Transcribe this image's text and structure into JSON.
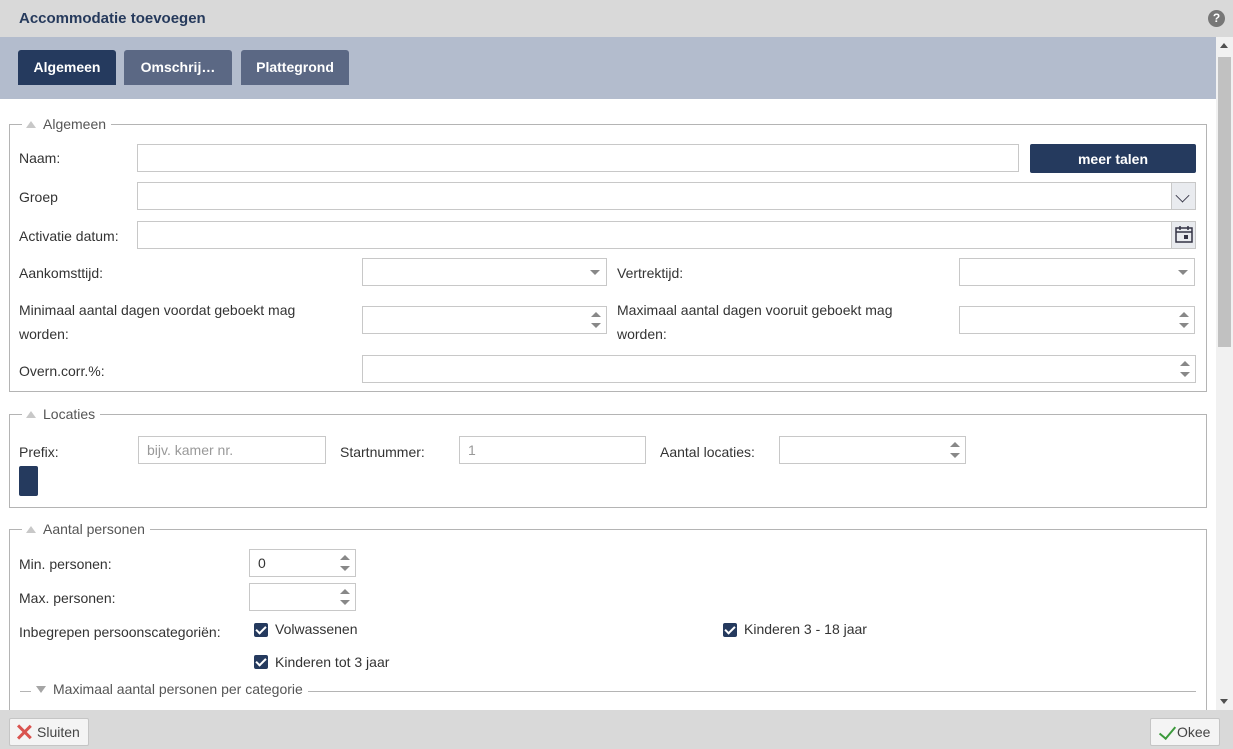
{
  "window": {
    "title": "Accommodatie toevoegen",
    "help_glyph": "?"
  },
  "tabs": [
    {
      "label": "Algemeen",
      "active": true
    },
    {
      "label": "Omschrij…",
      "active": false
    },
    {
      "label": "Plattegrond",
      "active": false
    }
  ],
  "algemeen": {
    "legend": "Algemeen",
    "naam_label": "Naam:",
    "naam_value": "",
    "meer_talen_label": "meer talen",
    "groep_label": "Groep",
    "groep_value": "",
    "activatie_label": "Activatie datum:",
    "activatie_value": "",
    "aankomst_label": "Aankomsttijd:",
    "vertrek_label": "Vertrektijd:",
    "min_dagen_label_1": "Minimaal aantal dagen voordat geboekt mag",
    "min_dagen_label_2": "worden:",
    "max_dagen_label_1": "Maximaal aantal dagen vooruit geboekt mag",
    "max_dagen_label_2": "worden:",
    "overn_label": "Overn.corr.%:"
  },
  "locaties": {
    "legend": "Locaties",
    "prefix_label": "Prefix:",
    "prefix_placeholder": "bijv. kamer nr.",
    "startnummer_label": "Startnummer:",
    "startnummer_placeholder": "1",
    "aantal_label": "Aantal locaties:"
  },
  "personen": {
    "legend": "Aantal personen",
    "min_label": "Min. personen:",
    "min_value": "0",
    "max_label": "Max. personen:",
    "max_value": "",
    "categorieen_label": "Inbegrepen persoonscategoriën:",
    "categories": [
      {
        "label": "Volwassenen",
        "checked": true
      },
      {
        "label": "Kinderen 3 - 18 jaar",
        "checked": true
      },
      {
        "label": "Kinderen tot 3 jaar",
        "checked": true
      }
    ],
    "sub_legend": "Maximaal aantal personen per categorie"
  },
  "footer": {
    "close_label": "Sluiten",
    "ok_label": "Okee"
  },
  "colors": {
    "primary": "#253a5e",
    "tab_inactive": "#5b6884",
    "tab_bar": "#b3bccd",
    "title_bar": "#d9d9d9"
  }
}
